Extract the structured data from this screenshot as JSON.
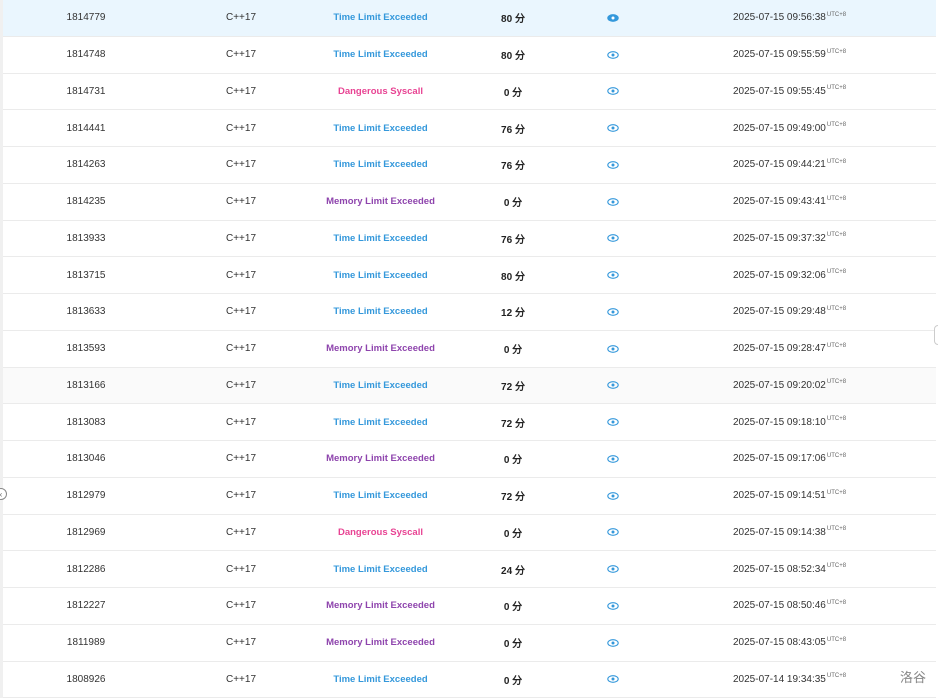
{
  "submissions": [
    {
      "id": "1814779",
      "lang": "C++17",
      "status": "Time Limit Exceeded",
      "status_type": "tle",
      "score": "80 分",
      "time": "2025-07-15 09:56:38",
      "tz": "UTC+8",
      "selected": true
    },
    {
      "id": "1814748",
      "lang": "C++17",
      "status": "Time Limit Exceeded",
      "status_type": "tle",
      "score": "80 分",
      "time": "2025-07-15 09:55:59",
      "tz": "UTC+8"
    },
    {
      "id": "1814731",
      "lang": "C++17",
      "status": "Dangerous Syscall",
      "status_type": "dang",
      "score": "0 分",
      "time": "2025-07-15 09:55:45",
      "tz": "UTC+8"
    },
    {
      "id": "1814441",
      "lang": "C++17",
      "status": "Time Limit Exceeded",
      "status_type": "tle",
      "score": "76 分",
      "time": "2025-07-15 09:49:00",
      "tz": "UTC+8"
    },
    {
      "id": "1814263",
      "lang": "C++17",
      "status": "Time Limit Exceeded",
      "status_type": "tle",
      "score": "76 分",
      "time": "2025-07-15 09:44:21",
      "tz": "UTC+8"
    },
    {
      "id": "1814235",
      "lang": "C++17",
      "status": "Memory Limit Exceeded",
      "status_type": "mle",
      "score": "0 分",
      "time": "2025-07-15 09:43:41",
      "tz": "UTC+8"
    },
    {
      "id": "1813933",
      "lang": "C++17",
      "status": "Time Limit Exceeded",
      "status_type": "tle",
      "score": "76 分",
      "time": "2025-07-15 09:37:32",
      "tz": "UTC+8"
    },
    {
      "id": "1813715",
      "lang": "C++17",
      "status": "Time Limit Exceeded",
      "status_type": "tle",
      "score": "80 分",
      "time": "2025-07-15 09:32:06",
      "tz": "UTC+8"
    },
    {
      "id": "1813633",
      "lang": "C++17",
      "status": "Time Limit Exceeded",
      "status_type": "tle",
      "score": "12 分",
      "time": "2025-07-15 09:29:48",
      "tz": "UTC+8"
    },
    {
      "id": "1813593",
      "lang": "C++17",
      "status": "Memory Limit Exceeded",
      "status_type": "mle",
      "score": "0 分",
      "time": "2025-07-15 09:28:47",
      "tz": "UTC+8"
    },
    {
      "id": "1813166",
      "lang": "C++17",
      "status": "Time Limit Exceeded",
      "status_type": "tle",
      "score": "72 分",
      "time": "2025-07-15 09:20:02",
      "tz": "UTC+8",
      "hover": true
    },
    {
      "id": "1813083",
      "lang": "C++17",
      "status": "Time Limit Exceeded",
      "status_type": "tle",
      "score": "72 分",
      "time": "2025-07-15 09:18:10",
      "tz": "UTC+8"
    },
    {
      "id": "1813046",
      "lang": "C++17",
      "status": "Memory Limit Exceeded",
      "status_type": "mle",
      "score": "0 分",
      "time": "2025-07-15 09:17:06",
      "tz": "UTC+8"
    },
    {
      "id": "1812979",
      "lang": "C++17",
      "status": "Time Limit Exceeded",
      "status_type": "tle",
      "score": "72 分",
      "time": "2025-07-15 09:14:51",
      "tz": "UTC+8"
    },
    {
      "id": "1812969",
      "lang": "C++17",
      "status": "Dangerous Syscall",
      "status_type": "dang",
      "score": "0 分",
      "time": "2025-07-15 09:14:38",
      "tz": "UTC+8"
    },
    {
      "id": "1812286",
      "lang": "C++17",
      "status": "Time Limit Exceeded",
      "status_type": "tle",
      "score": "24 分",
      "time": "2025-07-15 08:52:34",
      "tz": "UTC+8"
    },
    {
      "id": "1812227",
      "lang": "C++17",
      "status": "Memory Limit Exceeded",
      "status_type": "mle",
      "score": "0 分",
      "time": "2025-07-15 08:50:46",
      "tz": "UTC+8"
    },
    {
      "id": "1811989",
      "lang": "C++17",
      "status": "Memory Limit Exceeded",
      "status_type": "mle",
      "score": "0 分",
      "time": "2025-07-15 08:43:05",
      "tz": "UTC+8"
    },
    {
      "id": "1808926",
      "lang": "C++17",
      "status": "Time Limit Exceeded",
      "status_type": "tle",
      "score": "0 分",
      "time": "2025-07-14 19:34:35",
      "tz": "UTC+8"
    }
  ],
  "status_colors": {
    "tle": "#3498db",
    "dang": "#e84393",
    "mle": "#8e44ad"
  },
  "view_icon": "eye-icon",
  "watermark": "洛谷"
}
